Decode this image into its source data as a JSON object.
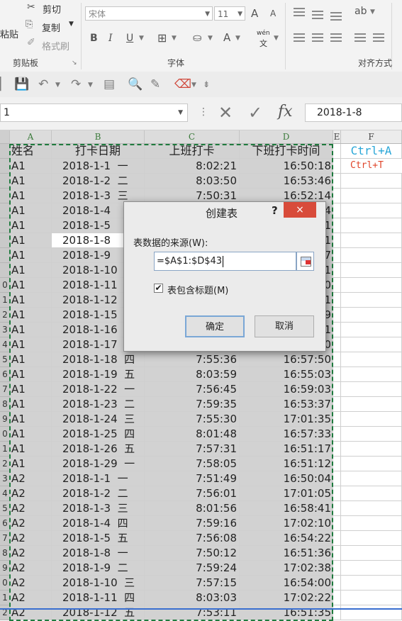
{
  "ribbon": {
    "clipboard": {
      "paste_label": "粘贴",
      "cut_label": "剪切",
      "copy_label": "复制",
      "format_painter_label": "格式刷",
      "group_label": "剪贴板"
    },
    "font": {
      "font_name": "宋体",
      "font_size": "11",
      "grow_label": "A",
      "shrink_label": "A",
      "bold": "B",
      "italic": "I",
      "underline": "U",
      "fill_label": "A",
      "wen_label": "wén",
      "group_label": "字体"
    },
    "alignment": {
      "group_label": "对齐方式"
    }
  },
  "formula_bar": {
    "name_box": "1",
    "formula": "2018-1-8",
    "fx_label": "fx"
  },
  "columns": [
    "A",
    "B",
    "C",
    "D",
    "E",
    "F"
  ],
  "headers": {
    "A": "姓名",
    "B": "打卡日期",
    "C": "上班打卡",
    "D": "下班打卡时间"
  },
  "notes": {
    "ctrl_a": "Ctrl+A",
    "ctrl_t": "Ctrl+T"
  },
  "rows": [
    {
      "num": "",
      "name": "A1",
      "date": "2018-1-1",
      "wk": "一",
      "in": "8:02:21",
      "out": "16:50:18"
    },
    {
      "num": "",
      "name": "A1",
      "date": "2018-1-2",
      "wk": "二",
      "in": "8:03:50",
      "out": "16:53:46"
    },
    {
      "num": "",
      "name": "A1",
      "date": "2018-1-3",
      "wk": "三",
      "in": "7:50:31",
      "out": "16:52:14"
    },
    {
      "num": "",
      "name": "A1",
      "date": "2018-1-4",
      "wk": "",
      "in": "",
      "out": "4"
    },
    {
      "num": "",
      "name": "A1",
      "date": "2018-1-5",
      "wk": "",
      "in": "",
      "out": "1"
    },
    {
      "num": "",
      "name": "A1",
      "date": "2018-1-8",
      "wk": "",
      "in": "",
      "out": "1"
    },
    {
      "num": "",
      "name": "A1",
      "date": "2018-1-9",
      "wk": "",
      "in": "",
      "out": "7"
    },
    {
      "num": "",
      "name": "A1",
      "date": "2018-1-10",
      "wk": "",
      "in": "",
      "out": "1"
    },
    {
      "num": "0",
      "name": "A1",
      "date": "2018-1-11",
      "wk": "",
      "in": "",
      "out": "0"
    },
    {
      "num": "1",
      "name": "A1",
      "date": "2018-1-12",
      "wk": "",
      "in": "",
      "out": "1"
    },
    {
      "num": "2",
      "name": "A1",
      "date": "2018-1-15",
      "wk": "",
      "in": "",
      "out": "9"
    },
    {
      "num": "3",
      "name": "A1",
      "date": "2018-1-16",
      "wk": "",
      "in": "",
      "out": "1"
    },
    {
      "num": "4",
      "name": "A1",
      "date": "2018-1-17",
      "wk": "",
      "in": "",
      "out": "0"
    },
    {
      "num": "5",
      "name": "A1",
      "date": "2018-1-18",
      "wk": "四",
      "in": "7:55:36",
      "out": "16:57:50"
    },
    {
      "num": "6",
      "name": "A1",
      "date": "2018-1-19",
      "wk": "五",
      "in": "8:03:59",
      "out": "16:55:03"
    },
    {
      "num": "7",
      "name": "A1",
      "date": "2018-1-22",
      "wk": "一",
      "in": "7:56:45",
      "out": "16:59:03"
    },
    {
      "num": "8",
      "name": "A1",
      "date": "2018-1-23",
      "wk": "二",
      "in": "7:59:35",
      "out": "16:53:37"
    },
    {
      "num": "9",
      "name": "A1",
      "date": "2018-1-24",
      "wk": "三",
      "in": "7:55:30",
      "out": "17:01:35"
    },
    {
      "num": "0",
      "name": "A1",
      "date": "2018-1-25",
      "wk": "四",
      "in": "8:01:48",
      "out": "16:57:33"
    },
    {
      "num": "1",
      "name": "A1",
      "date": "2018-1-26",
      "wk": "五",
      "in": "7:57:31",
      "out": "16:51:17"
    },
    {
      "num": "2",
      "name": "A1",
      "date": "2018-1-29",
      "wk": "一",
      "in": "7:58:05",
      "out": "16:51:12"
    },
    {
      "num": "3",
      "name": "A2",
      "date": "2018-1-1",
      "wk": "一",
      "in": "7:51:49",
      "out": "16:50:04"
    },
    {
      "num": "4",
      "name": "A2",
      "date": "2018-1-2",
      "wk": "二",
      "in": "7:56:01",
      "out": "17:01:05"
    },
    {
      "num": "5",
      "name": "A2",
      "date": "2018-1-3",
      "wk": "三",
      "in": "8:01:56",
      "out": "16:58:41"
    },
    {
      "num": "6",
      "name": "A2",
      "date": "2018-1-4",
      "wk": "四",
      "in": "7:59:16",
      "out": "17:02:10"
    },
    {
      "num": "7",
      "name": "A2",
      "date": "2018-1-5",
      "wk": "五",
      "in": "7:56:08",
      "out": "16:54:22"
    },
    {
      "num": "8",
      "name": "A2",
      "date": "2018-1-8",
      "wk": "一",
      "in": "7:50:12",
      "out": "16:51:36"
    },
    {
      "num": "9",
      "name": "A2",
      "date": "2018-1-9",
      "wk": "二",
      "in": "7:59:24",
      "out": "17:02:38"
    },
    {
      "num": "0",
      "name": "A2",
      "date": "2018-1-10",
      "wk": "三",
      "in": "7:57:15",
      "out": "16:54:00"
    },
    {
      "num": "1",
      "name": "A2",
      "date": "2018-1-11",
      "wk": "四",
      "in": "8:03:03",
      "out": "17:02:22"
    },
    {
      "num": "2",
      "name": "A2",
      "date": "2018-1-12",
      "wk": "五",
      "in": "7:53:11",
      "out": "16:51:35"
    }
  ],
  "dialog": {
    "title": "创建表",
    "help": "?",
    "close": "×",
    "source_label": "表数据的来源(W):",
    "source_value": "=$A$1:$D$43",
    "has_headers_label": "表包含标题(M)",
    "has_headers_checked": "✔",
    "ok_label": "确定",
    "cancel_label": "取消"
  },
  "colors": {
    "dialog_close": "#d84b3a",
    "marquee": "#1f7a3e",
    "ctrl_a": "#2aa7d8",
    "ctrl_t": "#e0452a"
  }
}
